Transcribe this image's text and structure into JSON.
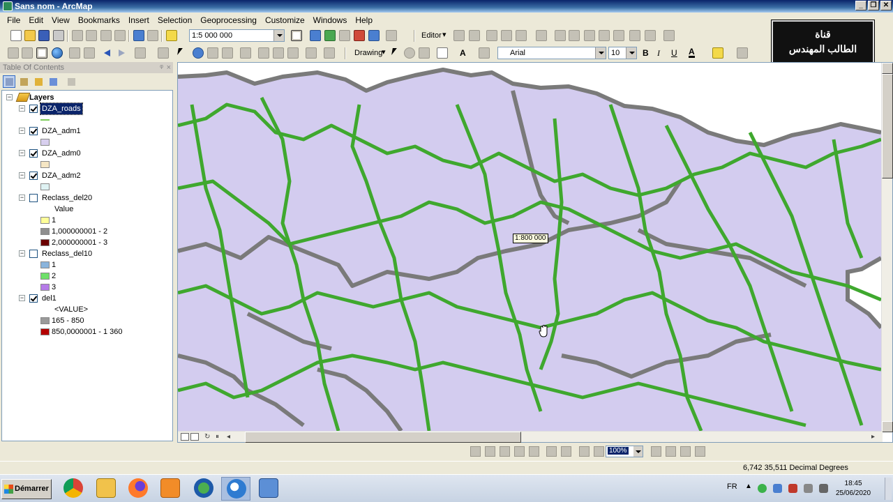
{
  "window": {
    "title": "Sans nom - ArcMap"
  },
  "menu": [
    "File",
    "Edit",
    "View",
    "Bookmarks",
    "Insert",
    "Selection",
    "Geoprocessing",
    "Customize",
    "Windows",
    "Help"
  ],
  "standard_toolbar": {
    "scale_value": "1:5 000 000"
  },
  "editor_toolbar": {
    "label": "Editor"
  },
  "draw_toolbar": {
    "drawing_label": "Drawing",
    "font_value": "Arial",
    "size_value": "10",
    "bold_label": "B",
    "italic_label": "I",
    "underline_label": "U",
    "font_color_label": "A"
  },
  "channel_logo": {
    "line1": "قناة",
    "line2": "الطالب المهندس"
  },
  "toc": {
    "title": "Table Of Contents",
    "pin": "ᵠ",
    "close": "×",
    "root": "Layers",
    "layers": [
      {
        "name": "DZA_roads",
        "checked": true,
        "selected": true,
        "line_color": "#7ccd58"
      },
      {
        "name": "DZA_adm1",
        "checked": true,
        "swatch": "#d8cfee"
      },
      {
        "name": "DZA_adm0",
        "checked": true,
        "swatch": "#f5e6c4"
      },
      {
        "name": "DZA_adm2",
        "checked": true,
        "swatch": "#dff2f3"
      },
      {
        "name": "Reclass_del20",
        "checked": false,
        "field": "Value",
        "classes": [
          {
            "label": "1",
            "color": "#ffff99"
          },
          {
            "label": "1,000000001 - 2",
            "color": "#8f8f8f"
          },
          {
            "label": "2,000000001 - 3",
            "color": "#6b0000"
          }
        ]
      },
      {
        "name": "Reclass_del10",
        "checked": false,
        "classes": [
          {
            "label": "1",
            "color": "#8ab4dc"
          },
          {
            "label": "2",
            "color": "#6ee06a"
          },
          {
            "label": "3",
            "color": "#b57be8"
          }
        ]
      },
      {
        "name": "del1",
        "checked": true,
        "field": "<VALUE>",
        "classes": [
          {
            "label": "165 - 850",
            "color": "#9a9a9a"
          },
          {
            "label": "850,0000001 - 1 360",
            "color": "#b40000"
          }
        ]
      }
    ]
  },
  "map": {
    "scale_tip": "1:800 000",
    "land_color": "#d3ccef",
    "road_color": "#3fa82e",
    "border_color": "#7a7a7a"
  },
  "layout_toolbar": {
    "zoom_value": "100%"
  },
  "status": {
    "coords": "6,742  35,511 Decimal Degrees"
  },
  "taskbar": {
    "start_label": "Démarrer",
    "lang": "FR",
    "time": "18:45",
    "date": "25/06/2020"
  }
}
